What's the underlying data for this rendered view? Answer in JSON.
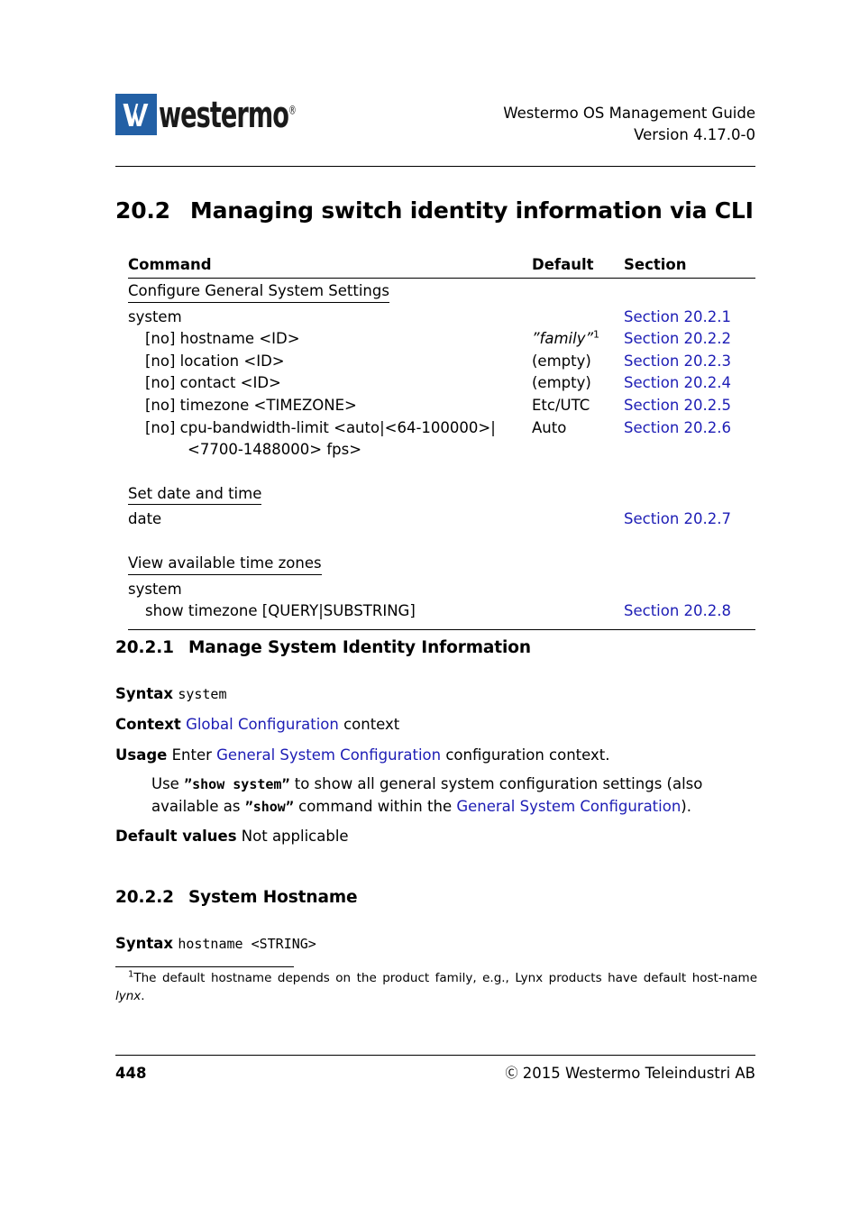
{
  "header": {
    "logo_word": "westermo",
    "logo_registered": "®",
    "title_line1": "Westermo OS Management Guide",
    "title_line2": "Version 4.17.0-0"
  },
  "section": {
    "number": "20.2",
    "title": "Managing switch identity information via CLI"
  },
  "table": {
    "columns": [
      "Command",
      "Default",
      "Section"
    ],
    "groups": [
      {
        "heading": "Configure General System Settings",
        "rows": [
          {
            "command": "system",
            "indent": 0,
            "default": "",
            "section": "Section 20.2.1"
          },
          {
            "command": "[no] hostname <ID>",
            "indent": 1,
            "default": "”family”",
            "default_sup": "1",
            "default_italic": true,
            "section": "Section 20.2.2"
          },
          {
            "command": "[no] location <ID>",
            "indent": 1,
            "default": "(empty)",
            "section": "Section 20.2.3"
          },
          {
            "command": "[no] contact <ID>",
            "indent": 1,
            "default": "(empty)",
            "section": "Section 20.2.4"
          },
          {
            "command": "[no] timezone <TIMEZONE>",
            "indent": 1,
            "default": "Etc/UTC",
            "section": "Section 20.2.5"
          },
          {
            "command": "[no] cpu-bandwidth-limit <auto|<64-100000>|",
            "indent": 1,
            "default": "Auto",
            "section": "Section 20.2.6"
          },
          {
            "command": "<7700-1488000> fps>",
            "indent": 2,
            "default": "",
            "section": ""
          }
        ]
      },
      {
        "heading": "Set date and time",
        "rows": [
          {
            "command": "date",
            "indent": 0,
            "default": "",
            "section": "Section 20.2.7"
          }
        ]
      },
      {
        "heading": "View available time zones",
        "rows": [
          {
            "command": "system",
            "indent": 0,
            "default": "",
            "section": ""
          },
          {
            "command": "show timezone [QUERY|SUBSTRING]",
            "indent": 1,
            "default": "",
            "section": "Section 20.2.8"
          }
        ]
      }
    ]
  },
  "subsection_2021": {
    "number": "20.2.1",
    "title": "Manage System Identity Information",
    "syntax_label": "Syntax",
    "syntax_value": "system",
    "context_label": "Context",
    "context_link": "Global Configuration",
    "context_tail": " context",
    "usage_label": "Usage",
    "usage_lead": " Enter ",
    "usage_link": "General System Configuration",
    "usage_tail": " configuration context.",
    "usage_body_1": "Use ",
    "usage_body_cmd1": "”show system”",
    "usage_body_2": " to show all general system configuration settings (also available as ",
    "usage_body_cmd2": "”show”",
    "usage_body_3": " command within the ",
    "usage_body_link": "General System Configuration",
    "usage_body_4": ").",
    "default_label": "Default values",
    "default_value": " Not applicable"
  },
  "subsection_2022": {
    "number": "20.2.2",
    "title": "System Hostname",
    "syntax_label": "Syntax",
    "syntax_value": "hostname <STRING>"
  },
  "footnote": {
    "marker": "1",
    "text_1": "The default hostname depends on the product family, e.g., Lynx products have default host-name ",
    "text_italic": "lynx",
    "text_2": "."
  },
  "footer": {
    "page_number": "448",
    "copyright_glyph": "Ⓒ",
    "copyright_text": "2015 Westermo Teleindustri AB"
  },
  "colors": {
    "link": "#1d1db5",
    "logo_blue": "#2360a5",
    "text": "#000000"
  }
}
